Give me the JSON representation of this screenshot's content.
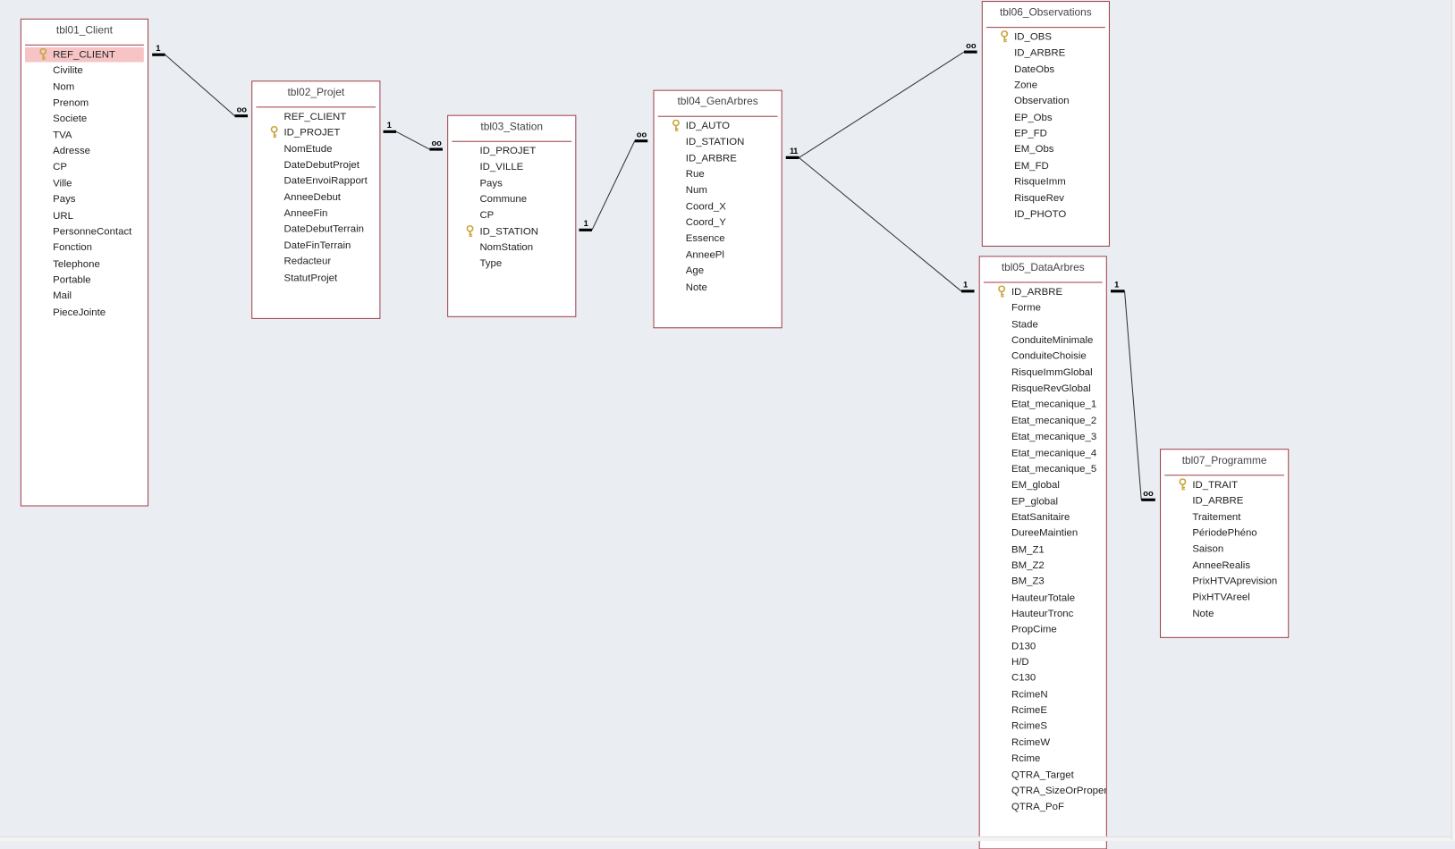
{
  "colors": {
    "table_border": "#a0414d",
    "selected_field": "#f7c4c6",
    "background": "#eaedf1",
    "key_icon": "#c9a640"
  },
  "tables": [
    {
      "id": "t1",
      "title": "tbl01_Client",
      "key": "REF_CLIENT",
      "selected": "REF_CLIENT",
      "fields": [
        "REF_CLIENT",
        "Civilite",
        "Nom",
        "Prenom",
        "Societe",
        "TVA",
        "Adresse",
        "CP",
        "Ville",
        "Pays",
        "URL",
        "PersonneContact",
        "Fonction",
        "Telephone",
        "Portable",
        "Mail",
        "PieceJointe"
      ]
    },
    {
      "id": "t2",
      "title": "tbl02_Projet",
      "key": "ID_PROJET",
      "fields": [
        "REF_CLIENT",
        "ID_PROJET",
        "NomEtude",
        "DateDebutProjet",
        "DateEnvoiRapport",
        "AnneeDebut",
        "AnneeFin",
        "DateDebutTerrain",
        "DateFinTerrain",
        "Redacteur",
        "StatutProjet"
      ]
    },
    {
      "id": "t3",
      "title": "tbl03_Station",
      "key": "ID_STATION",
      "fields": [
        "ID_PROJET",
        "ID_VILLE",
        "Pays",
        "Commune",
        "CP",
        "ID_STATION",
        "NomStation",
        "Type"
      ]
    },
    {
      "id": "t4",
      "title": "tbl04_GenArbres",
      "key": "ID_AUTO",
      "fields": [
        "ID_AUTO",
        "ID_STATION",
        "ID_ARBRE",
        "Rue",
        "Num",
        "Coord_X",
        "Coord_Y",
        "Essence",
        "AnneePl",
        "Age",
        "Note"
      ]
    },
    {
      "id": "t6",
      "title": "tbl06_Observations",
      "key": "ID_OBS",
      "fields": [
        "ID_OBS",
        "ID_ARBRE",
        "DateObs",
        "Zone",
        "Observation",
        "EP_Obs",
        "EP_FD",
        "EM_Obs",
        "EM_FD",
        "RisqueImm",
        "RisqueRev",
        "ID_PHOTO"
      ]
    },
    {
      "id": "t5",
      "title": "tbl05_DataArbres",
      "key": "ID_ARBRE",
      "fields": [
        "ID_ARBRE",
        "Forme",
        "Stade",
        "ConduiteMinimale",
        "ConduiteChoisie",
        "RisqueImmGlobal",
        "RisqueRevGlobal",
        "Etat_mecanique_1",
        "Etat_mecanique_2",
        "Etat_mecanique_3",
        "Etat_mecanique_4",
        "Etat_mecanique_5",
        "EM_global",
        "EP_global",
        "EtatSanitaire",
        "DureeMaintien",
        "BM_Z1",
        "BM_Z2",
        "BM_Z3",
        "HauteurTotale",
        "HauteurTronc",
        "PropCime",
        "D130",
        "H/D",
        "C130",
        "RcimeN",
        "RcimeE",
        "RcimeS",
        "RcimeW",
        "Rcime",
        "QTRA_Target",
        "QTRA_SizeOrPropert",
        "QTRA_PoF"
      ]
    },
    {
      "id": "t7",
      "title": "tbl07_Programme",
      "key": "ID_TRAIT",
      "fields": [
        "ID_TRAIT",
        "ID_ARBRE",
        "Traitement",
        "PériodePhéno",
        "Saison",
        "AnneeRealis",
        "PrixHTVAprevision",
        "PixHTVAreel",
        "Note"
      ]
    }
  ],
  "relationships": [
    {
      "from": "tbl01_Client",
      "to": "tbl02_Projet",
      "one": "1",
      "many": "∞"
    },
    {
      "from": "tbl02_Projet",
      "to": "tbl03_Station",
      "one": "1",
      "many": "∞"
    },
    {
      "from": "tbl03_Station",
      "to": "tbl04_GenArbres",
      "one": "1",
      "many": "∞"
    },
    {
      "from": "tbl04_GenArbres",
      "to": "tbl06_Observations",
      "one": "1",
      "many": "∞"
    },
    {
      "from": "tbl04_GenArbres",
      "to": "tbl05_DataArbres",
      "one": "1",
      "many": "1"
    },
    {
      "from": "tbl05_DataArbres",
      "to": "tbl07_Programme",
      "one": "1",
      "many": "∞"
    }
  ]
}
